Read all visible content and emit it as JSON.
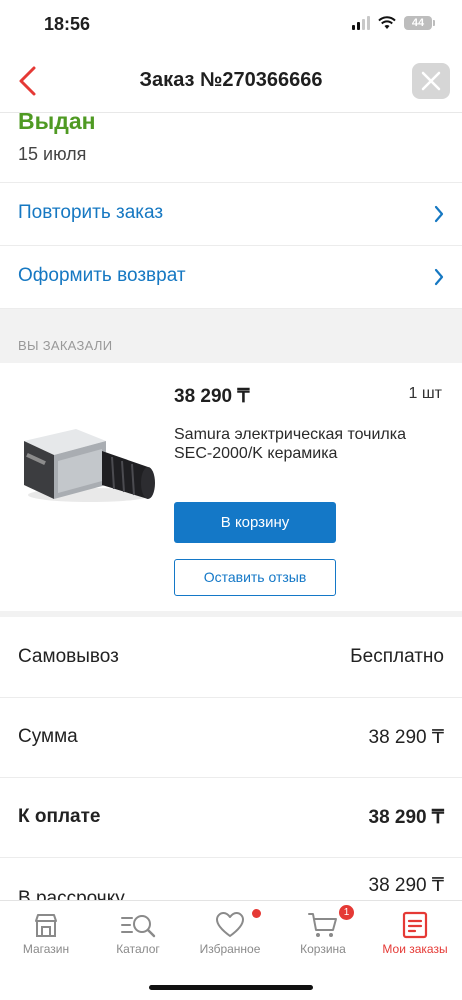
{
  "status_bar": {
    "time": "18:56",
    "battery": "44"
  },
  "header": {
    "title": "Заказ №270366666"
  },
  "order": {
    "status": "Выдан",
    "date": "15 июля"
  },
  "actions": {
    "repeat": "Повторить заказ",
    "return": "Оформить возврат"
  },
  "section": {
    "ordered_label": "ВЫ ЗАКАЗАЛИ"
  },
  "product": {
    "price": "38 290 ₸",
    "quantity": "1 шт",
    "name": "Samura электрическая точилка SEC-2000/K керамика",
    "add_to_cart": "В корзину",
    "leave_review": "Оставить отзыв"
  },
  "summary": {
    "pickup_label": "Самовывоз",
    "pickup_value": "Бесплатно",
    "sum_label": "Сумма",
    "sum_value": "38 290 ₸",
    "pay_label": "К оплате",
    "pay_value": "38 290 ₸",
    "installment_label": "В рассрочку",
    "installment_value": "38 290 ₸"
  },
  "tabbar": {
    "shop": "Магазин",
    "catalog": "Каталог",
    "favorites": "Избранное",
    "cart": "Корзина",
    "cart_count": "1",
    "orders": "Мои заказы"
  },
  "colors": {
    "accent_blue": "#1478c7",
    "status_green": "#4f9a23",
    "tab_active": "#e53935"
  }
}
